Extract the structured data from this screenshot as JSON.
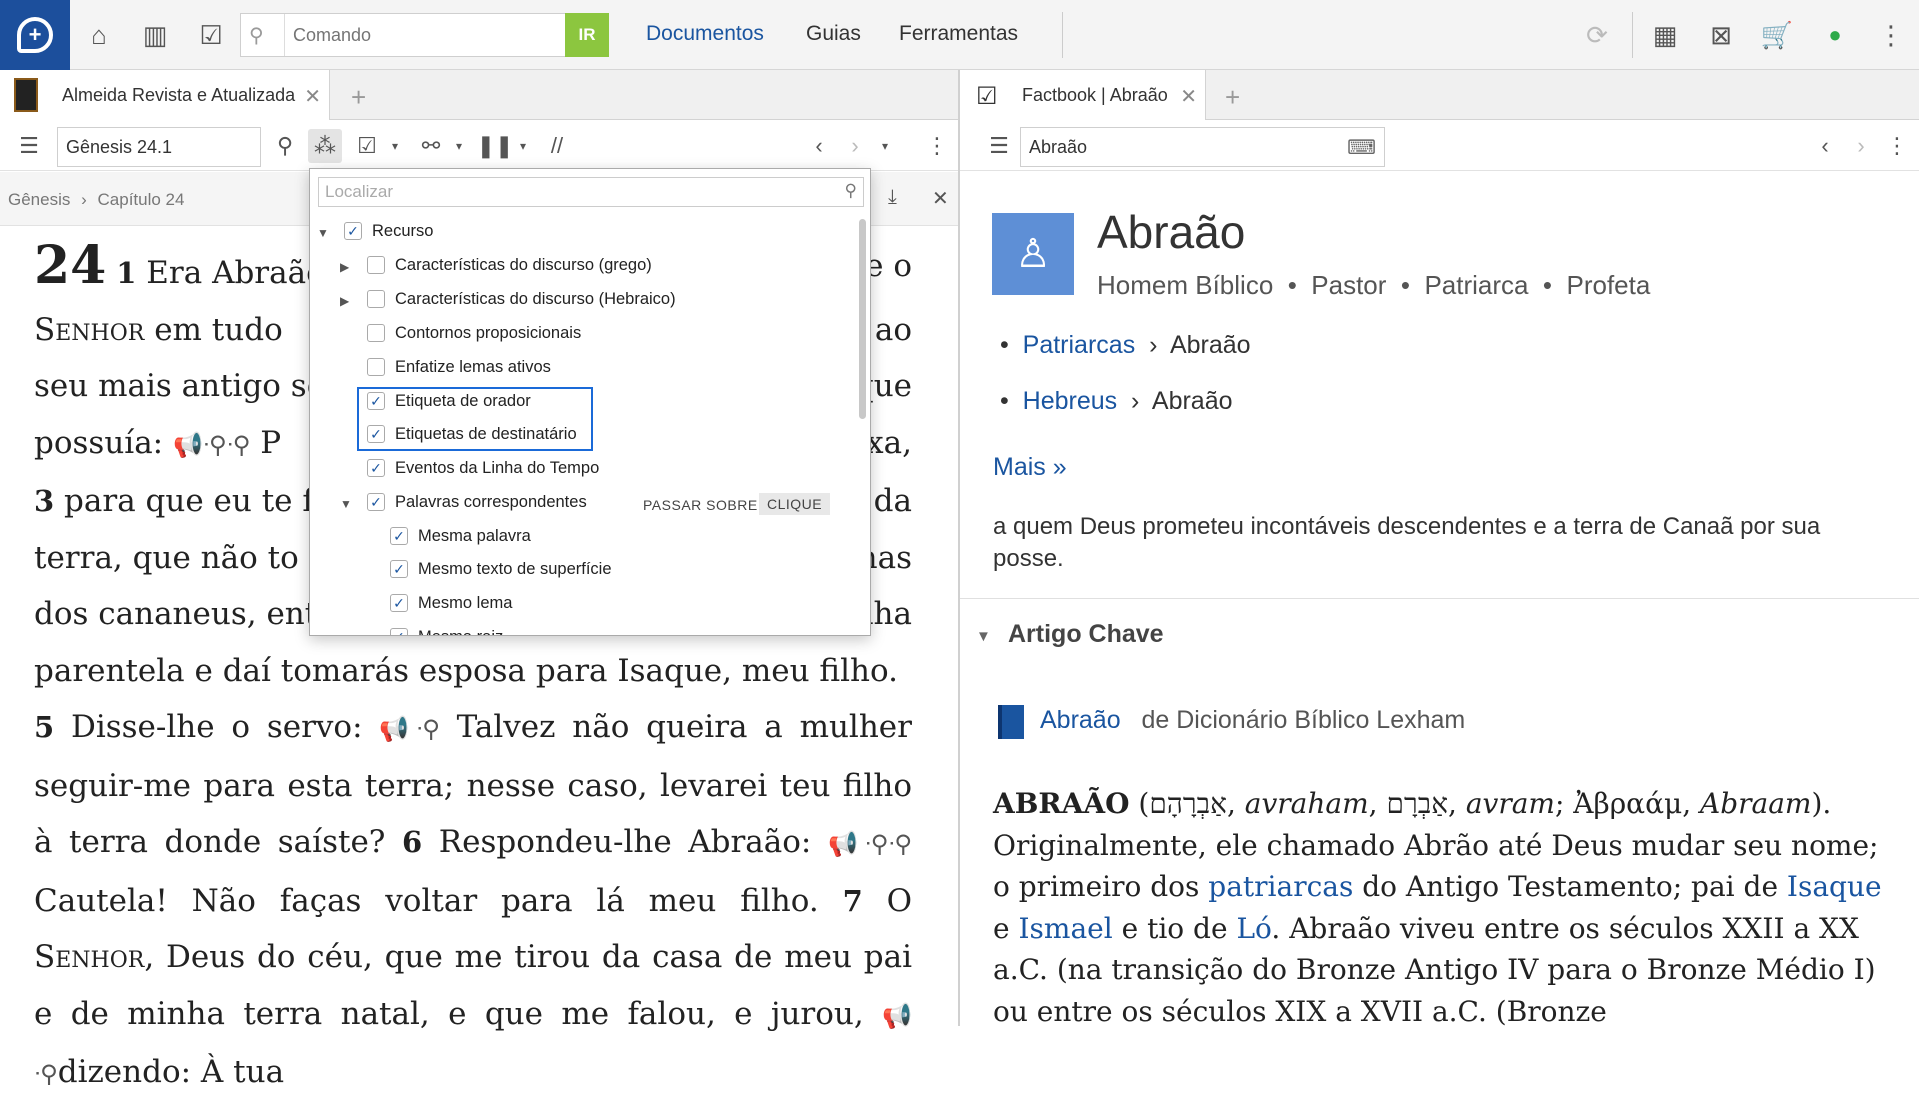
{
  "topbar": {
    "command_placeholder": "Comando",
    "go_label": "IR",
    "menu": [
      "Documentos",
      "Guias",
      "Ferramentas"
    ]
  },
  "left_panel": {
    "tab_title": "Almeida Revista e Atualizada",
    "reference": "Gênesis 24.1",
    "breadcrumb": {
      "book": "Gênesis",
      "chapter": "Capítulo 24"
    },
    "chapter_number": "24",
    "verses": {
      "v1_num": "1",
      "v1_a": "Era Abraão",
      "v1_end_e_o": "e o",
      "v1_senhor": "Senhor",
      "v1_b": "em tudo",
      "v1_ao": "ao",
      "v1_c": "seu mais antigo se",
      "v1_que": "que",
      "v1_d": "possuía:",
      "v1_p": "P",
      "v1_xa": "xa,",
      "v3_num": "3",
      "v3_a": "para que eu te fa",
      "v3_da": "da",
      "v3_b": "terra, que não to",
      "v3_nas": "nas",
      "v3_c": "dos cananeus, ent",
      "v3_nha": "nha",
      "v4_a": "parentela e daí tomarás esposa para Isaque, meu filho.",
      "v5_num": "5",
      "v5_a": "Disse-lhe o servo:",
      "v5_b": "Talvez não queira a mulher seguir-me para esta terra; nesse caso, levarei teu filho à terra donde saíste?",
      "v6_num": "6",
      "v6_a": "Respondeu-lhe Abraão:",
      "v6_b": "Cautela! Não faças voltar para lá meu filho.",
      "v7_num": "7",
      "v7_a": "O",
      "v7_senhor": "Senhor",
      "v7_b": ", Deus do céu, que me tirou da casa de meu pai e de minha terra natal, e que me falou, e jurou,",
      "v7_c": "dizendo: À tua"
    }
  },
  "dropdown": {
    "search_placeholder": "Localizar",
    "items": [
      {
        "label": "Recurso",
        "checked": true
      },
      {
        "label": "Características do discurso (grego)",
        "checked": false
      },
      {
        "label": "Características do discurso (Hebraico)",
        "checked": false
      },
      {
        "label": "Contornos proposicionais",
        "checked": false
      },
      {
        "label": "Enfatize lemas ativos",
        "checked": false
      },
      {
        "label": "Etiqueta de orador",
        "checked": true
      },
      {
        "label": "Etiquetas de destinatário",
        "checked": true
      },
      {
        "label": "Eventos da Linha do Tempo",
        "checked": true
      },
      {
        "label": "Palavras correspondentes",
        "checked": true
      },
      {
        "label": "Mesma palavra",
        "checked": true
      },
      {
        "label": "Mesmo texto de superfície",
        "checked": true
      },
      {
        "label": "Mesmo lema",
        "checked": true
      },
      {
        "label": "Mesma raiz",
        "checked": true
      }
    ],
    "hint_hover": "PASSAR SOBRE",
    "hint_click": "CLIQUE"
  },
  "right_panel": {
    "tab_title": "Factbook | Abraão",
    "search_value": "Abraão",
    "title": "Abraão",
    "tags": [
      "Homem Bíblico",
      "Pastor",
      "Patriarca",
      "Profeta"
    ],
    "categories": [
      {
        "link": "Patriarcas",
        "name": "Abraão"
      },
      {
        "link": "Hebreus",
        "name": "Abraão"
      }
    ],
    "more_label": "Mais »",
    "description": "a quem Deus prometeu incontáveis descendentes e a terra de Canaã por sua posse.",
    "section_title": "Artigo Chave",
    "article": {
      "link": "Abraão",
      "source": "de Dicionário Bíblico Lexham"
    },
    "body": {
      "headword": "ABRAÃO",
      "hebrew1": "אַבְרָהָם",
      "translit1": "avraham",
      "hebrew2": "אַבְרָם",
      "translit2": "avram",
      "greek": "Ἀβραάμ",
      "translit3": "Abraam",
      "t1": "). Originalmente, ele chamado Abrão até Deus mudar seu nome; o primeiro dos",
      "patriarcas": "patriarcas",
      "t2": "do Antigo Testamento; pai de",
      "isaque": "Isaque",
      "e": "e",
      "ismael": "Ismael",
      "t3": "e tio de",
      "lo": "Ló",
      "t4": ". Abraão viveu entre os séculos XXII a XX a.C. (na transição do Bronze Antigo IV para o Bronze Médio I) ou entre os séculos XIX a XVII a.C. (Bronze"
    }
  }
}
